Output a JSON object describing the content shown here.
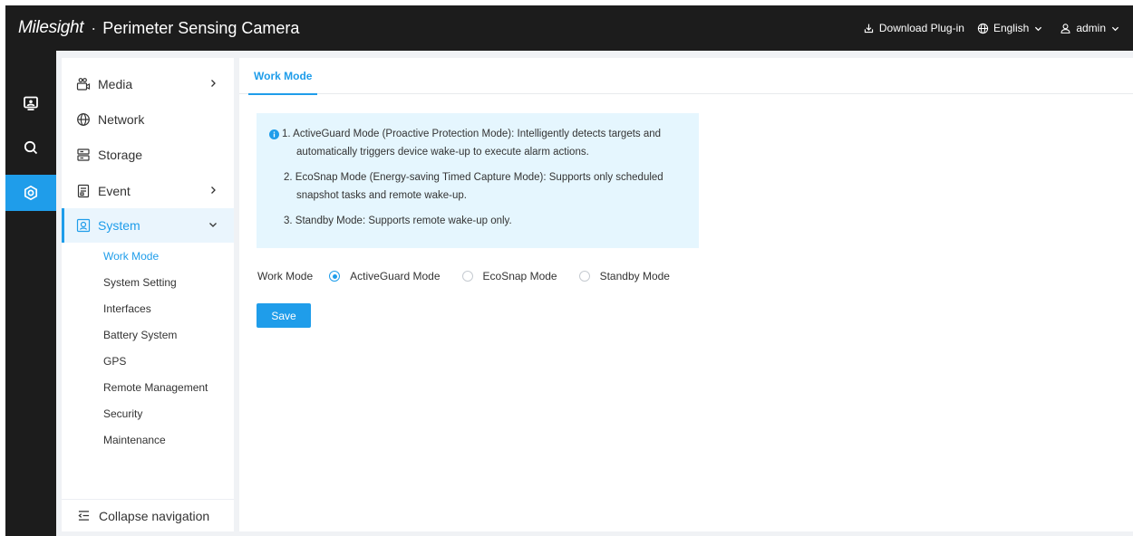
{
  "header": {
    "logo": "Milesight",
    "separator": "·",
    "title": "Perimeter Sensing Camera",
    "download_plugin": "Download Plug-in",
    "language": "English",
    "user": "admin"
  },
  "rail": {
    "items": [
      {
        "icon": "monitor-icon",
        "active": false
      },
      {
        "icon": "search-icon",
        "active": false
      },
      {
        "icon": "settings-icon",
        "active": true
      }
    ]
  },
  "sidebar": {
    "items": [
      {
        "label": "Media",
        "icon": "media-icon",
        "has_arrow": true
      },
      {
        "label": "Network",
        "icon": "globe-icon",
        "has_arrow": false
      },
      {
        "label": "Storage",
        "icon": "storage-icon",
        "has_arrow": false
      },
      {
        "label": "Event",
        "icon": "event-icon",
        "has_arrow": true
      },
      {
        "label": "System",
        "icon": "system-icon",
        "expanded": true,
        "active": true
      }
    ],
    "sub_items": [
      "Work Mode",
      "System Setting",
      "Interfaces",
      "Battery System",
      "GPS",
      "Remote Management",
      "Security",
      "Maintenance"
    ],
    "active_sub": "Work Mode",
    "collapse_label": "Collapse navigation"
  },
  "main": {
    "tab": "Work Mode",
    "notice": [
      "1. ActiveGuard Mode (Proactive Protection Mode): Intelligently detects targets and",
      "automatically triggers device wake-up to execute alarm actions.",
      "2. EcoSnap Mode (Energy-saving Timed Capture Mode): Supports only scheduled",
      "snapshot tasks and remote wake-up.",
      "3. Standby Mode: Supports remote wake-up only."
    ],
    "work_mode_label": "Work Mode",
    "options": [
      "ActiveGuard Mode",
      "EcoSnap Mode",
      "Standby Mode"
    ],
    "selected": "ActiveGuard Mode",
    "save_label": "Save"
  },
  "colors": {
    "accent": "#1f9dea",
    "topbar": "#1c1c1c",
    "notice_bg": "#e5f6fe",
    "page_bg": "#f0f2f5"
  }
}
